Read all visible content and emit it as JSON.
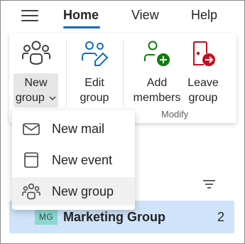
{
  "tabs": [
    {
      "label": "Home",
      "selected": true
    },
    {
      "label": "View",
      "selected": false
    },
    {
      "label": "Help",
      "selected": false
    }
  ],
  "ribbon": {
    "new_group": {
      "line1": "New",
      "line2": "group",
      "chevron": "chevron-down-icon",
      "icon": "people-group-icon"
    },
    "edit_group": {
      "line1": "Edit",
      "line2": "group",
      "icon": "people-edit-icon"
    },
    "add_members": {
      "line1": "Add",
      "line2": "members",
      "icon": "person-add-icon"
    },
    "leave_group": {
      "line1": "Leave",
      "line2": "group",
      "icon": "door-arrow-right-icon"
    },
    "group_label": "Modify"
  },
  "menu": {
    "items": [
      {
        "label": "New mail",
        "icon": "mail-icon"
      },
      {
        "label": "New event",
        "icon": "calendar-icon"
      },
      {
        "label": "New group",
        "icon": "people-group-icon",
        "hovered": true
      }
    ]
  },
  "list": {
    "rows": [
      {
        "initials": "MG",
        "name": "Marketing Group",
        "count": "2",
        "selected": true
      }
    ]
  },
  "colors": {
    "accent": "#0f6cbd",
    "selected_row": "#cfe4fa",
    "avatar_bg": "#8fd6cf",
    "add_icon": "#107c10",
    "leave_icon": "#c50f1f",
    "edit_icon": "#0f6cbd"
  }
}
